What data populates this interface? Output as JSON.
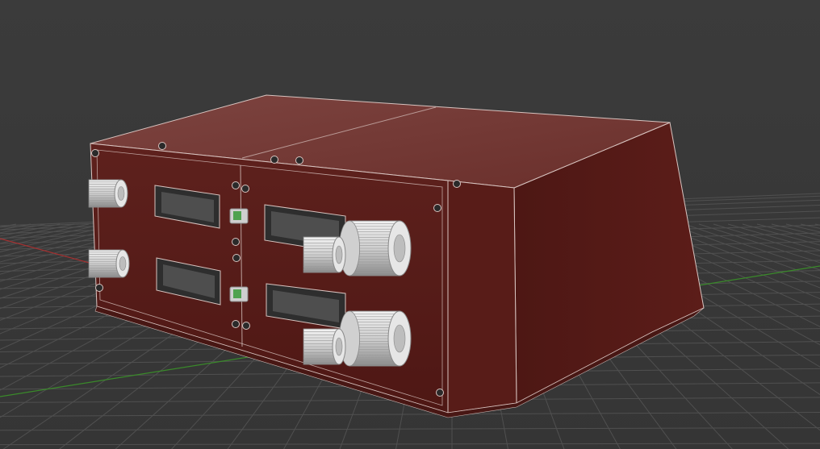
{
  "viewport": {
    "background": "#3a3a3a",
    "grid_color": "#555555",
    "x_axis_color": "#b03030",
    "y_axis_color": "#3a8a2a"
  },
  "model": {
    "body_color": "#5a1c18",
    "top_color": "#6f3531",
    "side_color": "#4a1512",
    "wire_color": "#d8c4c0",
    "knob_color": "#d9d9d9",
    "indicator_color": "#4fa24f"
  },
  "icons": {
    "knob": "rotary-knob-icon",
    "screw": "screw-hole-icon",
    "led": "green-indicator-icon"
  }
}
